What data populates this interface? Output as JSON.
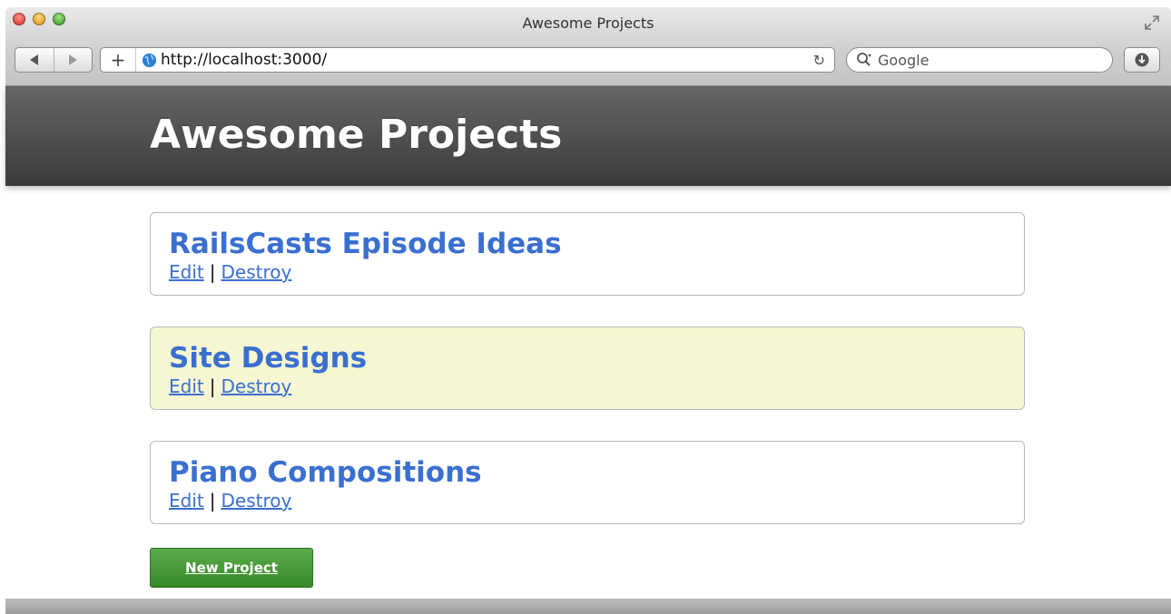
{
  "window": {
    "title": "Awesome Projects"
  },
  "toolbar": {
    "add_label": "+",
    "url": "http://localhost:3000/",
    "search_placeholder": "Google"
  },
  "page": {
    "title": "Awesome Projects",
    "projects": [
      {
        "name": "RailsCasts Episode Ideas",
        "edit_label": "Edit",
        "separator": "|",
        "destroy_label": "Destroy",
        "highlighted": false
      },
      {
        "name": "Site Designs",
        "edit_label": "Edit",
        "separator": "|",
        "destroy_label": "Destroy",
        "highlighted": true
      },
      {
        "name": "Piano Compositions",
        "edit_label": "Edit",
        "separator": "|",
        "destroy_label": "Destroy",
        "highlighted": false
      }
    ],
    "new_button_label": "New Project"
  },
  "colors": {
    "link": "#3a6fd0",
    "highlight": "#f6f7d2",
    "button": "#45992f",
    "header": "#4a4a4a"
  }
}
